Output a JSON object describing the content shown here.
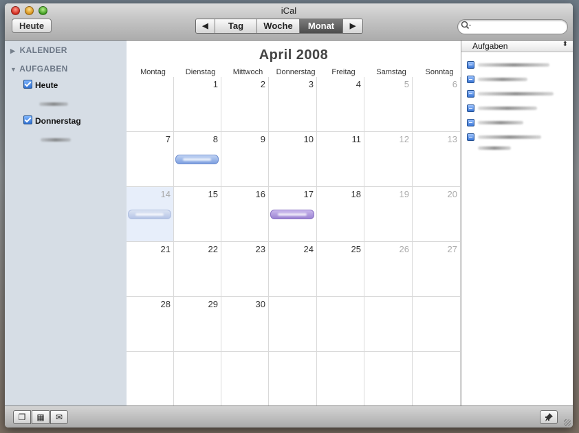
{
  "window": {
    "title": "iCal"
  },
  "toolbar": {
    "today_label": "Heute",
    "view_tabs": [
      {
        "label": "Tag",
        "selected": false
      },
      {
        "label": "Woche",
        "selected": false
      },
      {
        "label": "Monat",
        "selected": true
      }
    ],
    "prev_icon": "◀",
    "next_icon": "▶",
    "search": {
      "placeholder": "",
      "value": ""
    }
  },
  "sidebar": {
    "calendars_header": "KALENDER",
    "tasks_header": "AUFGABEN",
    "task_groups": [
      {
        "label": "Heute",
        "checked": true
      },
      {
        "label": "Donnerstag",
        "checked": true
      }
    ]
  },
  "calendar": {
    "title": "April 2008",
    "day_names": [
      "Montag",
      "Dienstag",
      "Mittwoch",
      "Donnerstag",
      "Freitag",
      "Samstag",
      "Sonntag"
    ],
    "weeks": [
      [
        "",
        "1",
        "2",
        "3",
        "4",
        "5",
        "6"
      ],
      [
        "7",
        "8",
        "9",
        "10",
        "11",
        "12",
        "13"
      ],
      [
        "14",
        "15",
        "16",
        "17",
        "18",
        "19",
        "20"
      ],
      [
        "21",
        "22",
        "23",
        "24",
        "25",
        "26",
        "27"
      ],
      [
        "28",
        "29",
        "30",
        "",
        "",
        "",
        ""
      ],
      [
        "",
        "",
        "",
        "",
        "",
        "",
        ""
      ]
    ],
    "today": "14",
    "events": [
      {
        "date": "8",
        "color": "blue"
      },
      {
        "date": "14",
        "color": "light-blue"
      },
      {
        "date": "17",
        "color": "purple"
      }
    ]
  },
  "tasks_panel": {
    "header": "Aufgaben",
    "sort_icon": "⬍"
  },
  "bottom_bar": {
    "calendars_icon": "❐",
    "minical_icon": "▦",
    "mail_icon": "✉",
    "pin_icon": "📌"
  },
  "colors": {
    "today_cell": "#e7eefa",
    "event_blue": "#7ea0e0",
    "event_purple": "#9b83d2",
    "sidebar_bg": "#d6dde5"
  }
}
